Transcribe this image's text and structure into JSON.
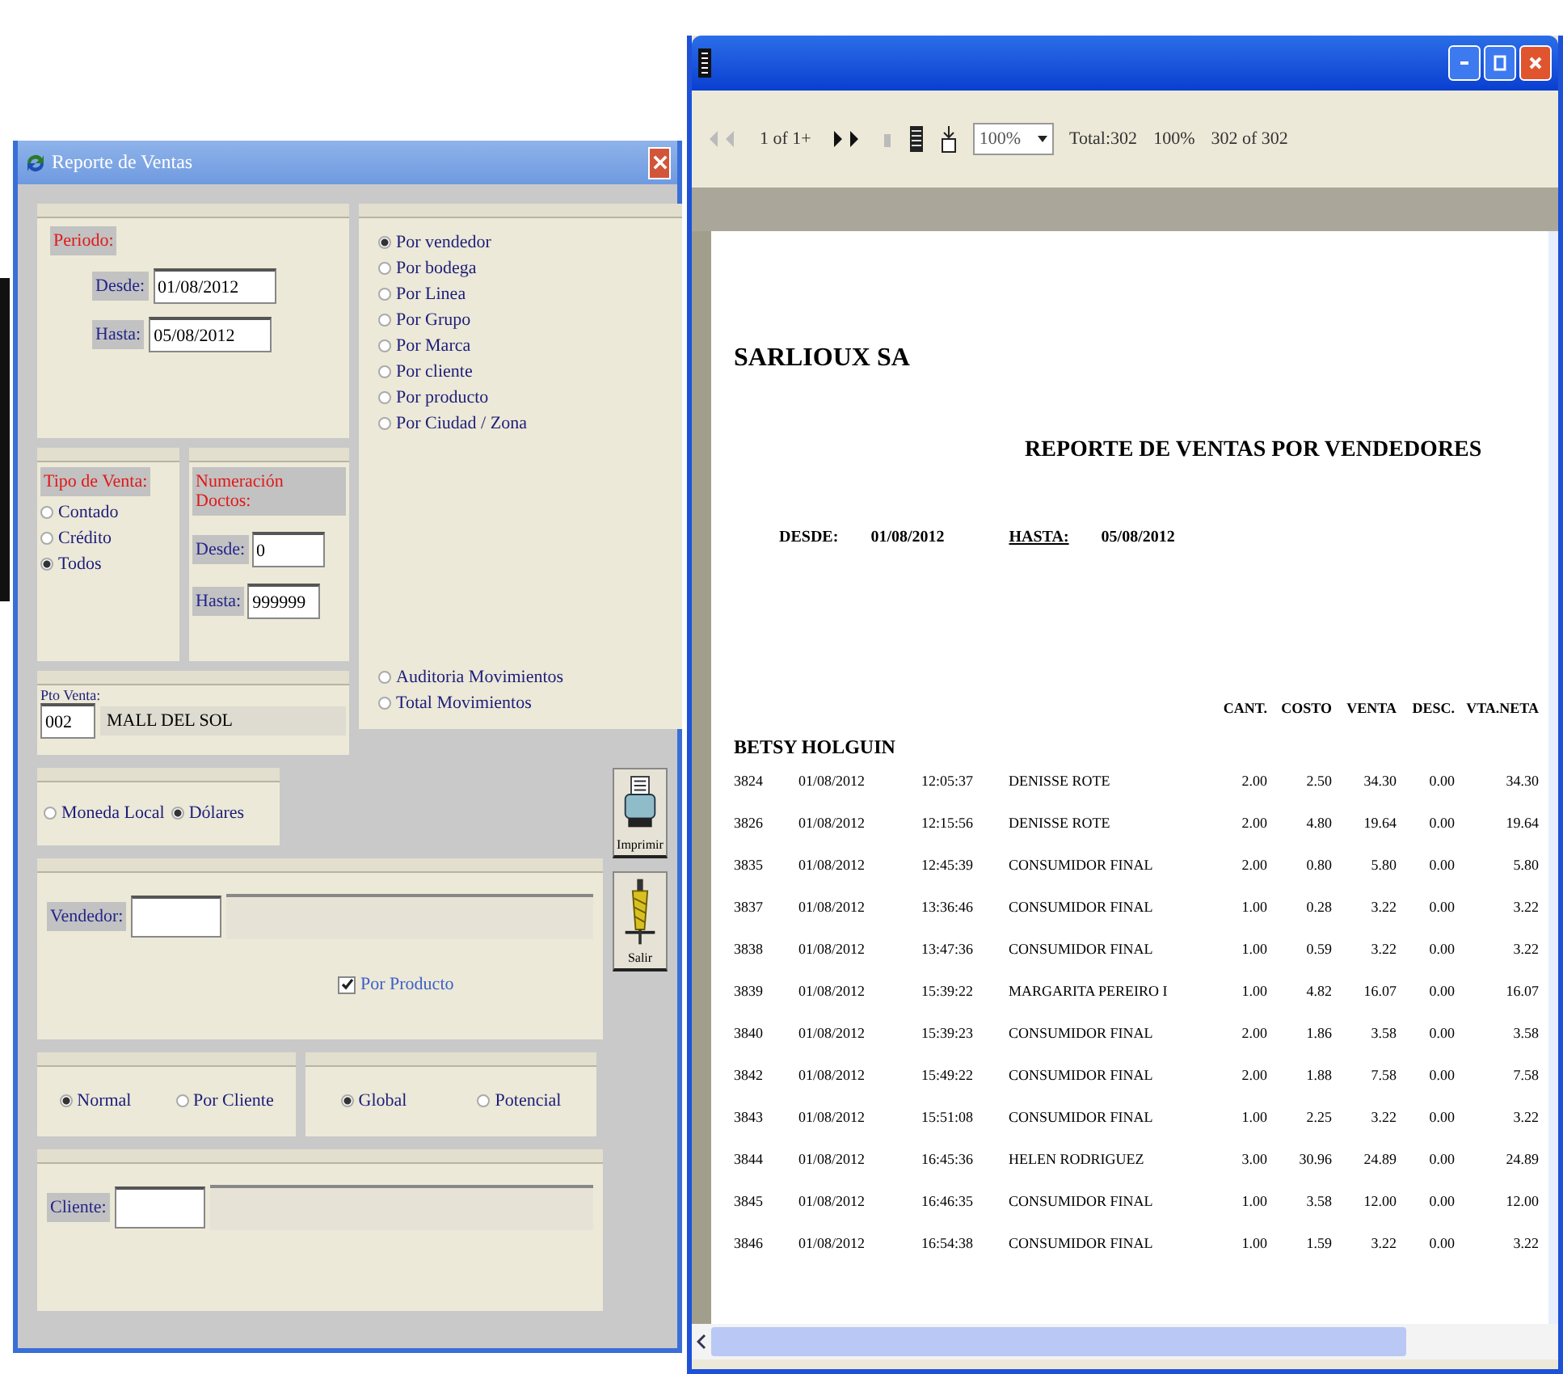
{
  "report_window": {
    "title": "Reporte de Ventas",
    "periodo": {
      "label": "Periodo:",
      "desde_label": "Desde:",
      "desde_value": "01/08/2012",
      "hasta_label": "Hasta:",
      "hasta_value": "05/08/2012"
    },
    "tipo_venta": {
      "label": "Tipo de Venta:",
      "options": [
        {
          "label": "Contado",
          "selected": false
        },
        {
          "label": "Crédito",
          "selected": false
        },
        {
          "label": "Todos",
          "selected": true
        }
      ]
    },
    "numeracion": {
      "label": "Numeración Doctos:",
      "desde_label": "Desde:",
      "desde_value": "0",
      "hasta_label": "Hasta:",
      "hasta_value": "999999"
    },
    "punto_venta": {
      "label": "Pto Venta:",
      "code": "002",
      "name": "MALL DEL SOL"
    },
    "group_by": [
      {
        "label": "Por vendedor",
        "selected": true
      },
      {
        "label": "Por bodega",
        "selected": false
      },
      {
        "label": "Por Linea",
        "selected": false
      },
      {
        "label": "Por Grupo",
        "selected": false
      },
      {
        "label": "Por Marca",
        "selected": false
      },
      {
        "label": "Por cliente",
        "selected": false
      },
      {
        "label": "Por producto",
        "selected": false
      },
      {
        "label": "Por Ciudad / Zona",
        "selected": false
      }
    ],
    "movements": [
      {
        "label": "Auditoria Movimientos",
        "selected": false
      },
      {
        "label": "Total Movimientos",
        "selected": false
      }
    ],
    "moneda": [
      {
        "label": "Moneda Local",
        "selected": false
      },
      {
        "label": "Dólares",
        "selected": true
      }
    ],
    "buttons": [
      {
        "label": "Imprimir",
        "kind": "print"
      },
      {
        "label": "Salir",
        "kind": "exit"
      }
    ],
    "vendedor": {
      "label": "Vendedor:"
    },
    "por_producto": {
      "label": "Por Producto",
      "checked": true
    },
    "tipo_reporte": [
      {
        "label": "Normal",
        "selected": true
      },
      {
        "label": "Por Cliente",
        "selected": false
      }
    ],
    "alcance": [
      {
        "label": "Global",
        "selected": true
      },
      {
        "label": "Potencial",
        "selected": false
      }
    ],
    "cliente": {
      "label": "Cliente:"
    }
  },
  "viewer_window": {
    "toolbar": {
      "page": "1 of 1+",
      "zoom": "100%",
      "total": "Total:302",
      "percent": "100%",
      "count": "302 of 302"
    },
    "report": {
      "company": "SARLIOUX SA",
      "title": "REPORTE DE VENTAS POR VENDEDORES",
      "desde_label": "DESDE:",
      "desde_value": "01/08/2012",
      "hasta_label": "HASTA:",
      "hasta_value": "05/08/2012",
      "columns": [
        "CANT.",
        "COSTO",
        "VENTA",
        "DESC.",
        "VTA.NETA"
      ],
      "group": "BETSY HOLGUIN",
      "rows": [
        {
          "document": "3824",
          "date": "01/08/2012",
          "time": "12:05:37",
          "customer": "DENISSE ROTE",
          "amounts": [
            "2.00",
            "2.50",
            "34.30",
            "0.00",
            "34.30"
          ]
        },
        {
          "document": "3826",
          "date": "01/08/2012",
          "time": "12:15:56",
          "customer": "DENISSE ROTE",
          "amounts": [
            "2.00",
            "4.80",
            "19.64",
            "0.00",
            "19.64"
          ]
        },
        {
          "document": "3835",
          "date": "01/08/2012",
          "time": "12:45:39",
          "customer": "CONSUMIDOR FINAL",
          "amounts": [
            "2.00",
            "0.80",
            "5.80",
            "0.00",
            "5.80"
          ]
        },
        {
          "document": "3837",
          "date": "01/08/2012",
          "time": "13:36:46",
          "customer": "CONSUMIDOR FINAL",
          "amounts": [
            "1.00",
            "0.28",
            "3.22",
            "0.00",
            "3.22"
          ]
        },
        {
          "document": "3838",
          "date": "01/08/2012",
          "time": "13:47:36",
          "customer": "CONSUMIDOR FINAL",
          "amounts": [
            "1.00",
            "0.59",
            "3.22",
            "0.00",
            "3.22"
          ]
        },
        {
          "document": "3839",
          "date": "01/08/2012",
          "time": "15:39:22",
          "customer": "MARGARITA PEREIRO I",
          "amounts": [
            "1.00",
            "4.82",
            "16.07",
            "0.00",
            "16.07"
          ]
        },
        {
          "document": "3840",
          "date": "01/08/2012",
          "time": "15:39:23",
          "customer": "CONSUMIDOR FINAL",
          "amounts": [
            "2.00",
            "1.86",
            "3.58",
            "0.00",
            "3.58"
          ]
        },
        {
          "document": "3842",
          "date": "01/08/2012",
          "time": "15:49:22",
          "customer": "CONSUMIDOR FINAL",
          "amounts": [
            "2.00",
            "1.88",
            "7.58",
            "0.00",
            "7.58"
          ]
        },
        {
          "document": "3843",
          "date": "01/08/2012",
          "time": "15:51:08",
          "customer": "CONSUMIDOR FINAL",
          "amounts": [
            "1.00",
            "2.25",
            "3.22",
            "0.00",
            "3.22"
          ]
        },
        {
          "document": "3844",
          "date": "01/08/2012",
          "time": "16:45:36",
          "customer": "HELEN RODRIGUEZ",
          "amounts": [
            "3.00",
            "30.96",
            "24.89",
            "0.00",
            "24.89"
          ]
        },
        {
          "document": "3845",
          "date": "01/08/2012",
          "time": "16:46:35",
          "customer": "CONSUMIDOR FINAL",
          "amounts": [
            "1.00",
            "3.58",
            "12.00",
            "0.00",
            "12.00"
          ]
        },
        {
          "document": "3846",
          "date": "01/08/2012",
          "time": "16:54:38",
          "customer": "CONSUMIDOR FINAL",
          "amounts": [
            "1.00",
            "1.59",
            "3.22",
            "0.00",
            "3.22"
          ]
        }
      ]
    }
  }
}
